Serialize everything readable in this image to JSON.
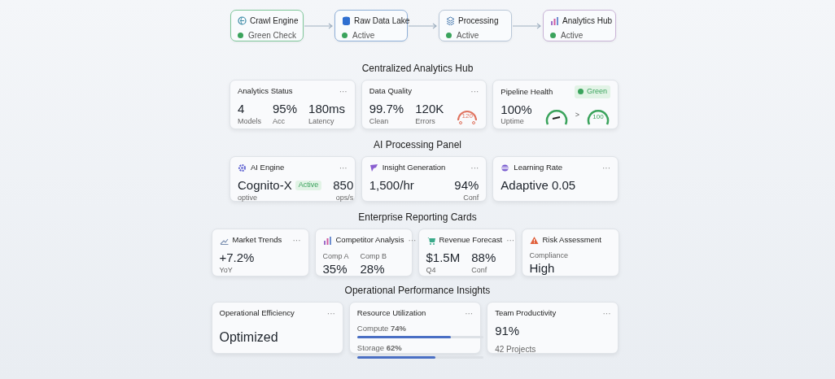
{
  "pipeline": [
    {
      "title": "Crawl Engine",
      "status": "Green Check",
      "color": "#7fc79a"
    },
    {
      "title": "Raw Data Lake",
      "status": "Active",
      "color": "#8fb0d8"
    },
    {
      "title": "Processing",
      "status": "Active",
      "color": "#b9c7d8"
    },
    {
      "title": "Analytics Hub",
      "status": "Active",
      "color": "#c9b3d6"
    }
  ],
  "sections": [
    {
      "title": "Centralized Analytics Hub",
      "cards": [
        {
          "kind": "stats",
          "title": "Analytics Status",
          "menu": "···",
          "metrics": [
            {
              "value": "4",
              "label": "Models"
            },
            {
              "value": "95%",
              "label": "Acc"
            },
            {
              "value": "180ms",
              "label": "Latency"
            }
          ]
        },
        {
          "kind": "stats",
          "title": "Data Quality",
          "menu": "···",
          "metrics": [
            {
              "value": "99.7%",
              "label": "Clean"
            },
            {
              "value": "120K",
              "label": "Errors"
            }
          ],
          "gauges": [
            {
              "kind": "dial",
              "reading": "120",
              "color": "#e0735f"
            }
          ]
        },
        {
          "kind": "stats",
          "title": "Pipeline Health",
          "badge": "Green",
          "metrics": [
            {
              "value": "100%",
              "label": "Uptime"
            }
          ],
          "gauges": [
            {
              "kind": "needle",
              "color": "#3aa35c"
            },
            {
              "kind": "ring",
              "separator": ">",
              "reading": "100",
              "color": "#3aa35c"
            }
          ]
        }
      ]
    },
    {
      "title": "AI Processing Panel",
      "cards": [
        {
          "kind": "stats",
          "title": "AI Engine",
          "menu": "···",
          "metrics": [
            {
              "value": "Cognito-X",
              "label": "optive",
              "badge": "Active"
            },
            {
              "kind": "aside",
              "value": "850",
              "label": "ops/s"
            }
          ]
        },
        {
          "kind": "stats",
          "title": "Insight Generation",
          "menu": "···",
          "metrics": [
            {
              "value": "1,500/hr"
            },
            {
              "kind": "aside",
              "value": "94%",
              "label": "Conf"
            }
          ]
        },
        {
          "kind": "stats",
          "title": "Learning Rate",
          "menu": "···",
          "metrics": [
            {
              "value": "Adaptive 0.05"
            }
          ]
        }
      ]
    },
    {
      "title": "Enterprise Reporting Cards",
      "cards": [
        {
          "kind": "stats",
          "title": "Market Trends",
          "menu": "···",
          "metrics": [
            {
              "value": "+7.2%",
              "label": "YoY"
            }
          ]
        },
        {
          "kind": "labeled",
          "title": "Competitor Analysis",
          "menu": "···",
          "metrics": [
            {
              "value": "35%",
              "label": "Comp A"
            },
            {
              "value": "28%",
              "label": "Comp B"
            }
          ]
        },
        {
          "kind": "stats",
          "title": "Revenue Forecast",
          "menu": "···",
          "metrics": [
            {
              "value": "$1.5M",
              "label": "Q4"
            },
            {
              "value": "88%",
              "label": "Conf"
            }
          ]
        },
        {
          "kind": "labeled",
          "title": "Risk Assessment",
          "metrics": [
            {
              "value": "High",
              "label": "Compliance"
            }
          ]
        }
      ]
    },
    {
      "title": "Operational Performance Insights",
      "cards": [
        {
          "kind": "big",
          "title": "Operational Efficiency",
          "menu": "···",
          "metrics": [
            {
              "value": "Optimized"
            }
          ]
        },
        {
          "kind": "bars",
          "title": "Resource Utilization",
          "menu": "···",
          "bars": [
            {
              "label": "Compute",
              "value": "74%",
              "level": 0.74
            },
            {
              "label": "Storage",
              "value": "62%",
              "level": 0.62
            }
          ]
        },
        {
          "kind": "stats",
          "title": "Team Productivity",
          "menu": "···",
          "metrics": [
            {
              "value": "91%"
            },
            {
              "value": "42 Projects",
              "kind": "note"
            }
          ]
        }
      ]
    }
  ]
}
